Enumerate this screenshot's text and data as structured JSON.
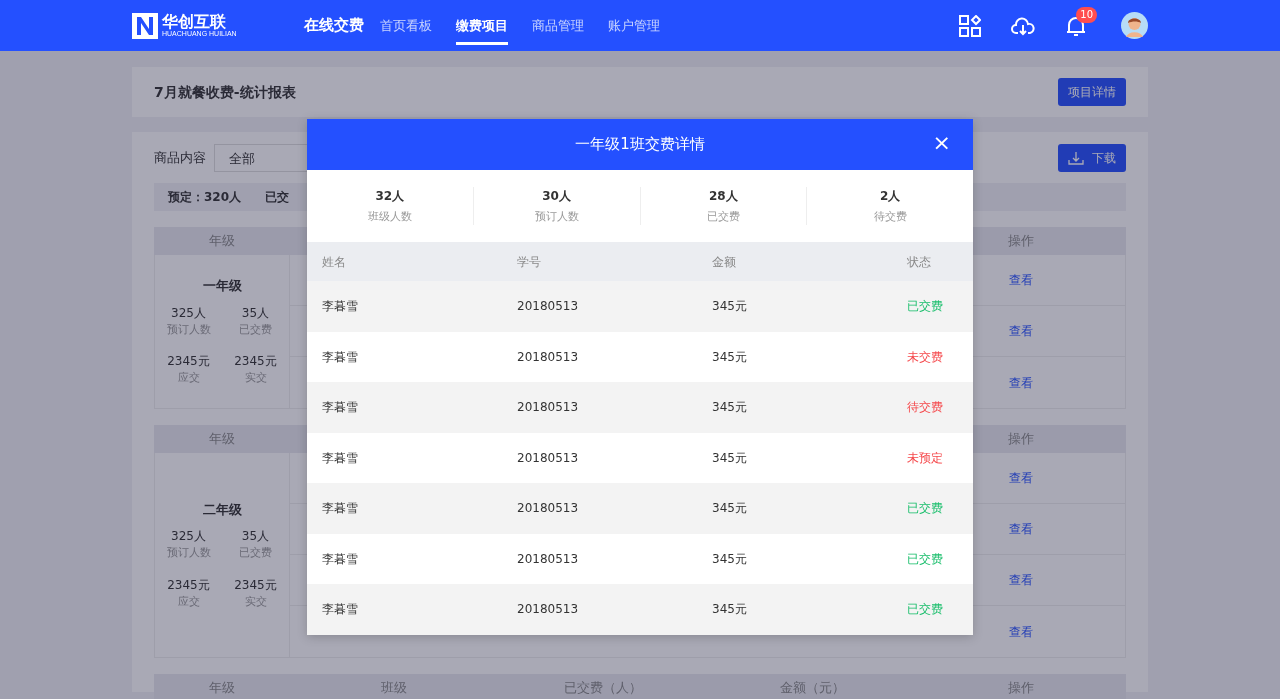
{
  "nav": {
    "logo_text": "华创互联",
    "logo_subtext": "HUACHUANG HUILIAN",
    "app_title": "在线交费",
    "tabs": [
      {
        "label": "首页看板",
        "selected": false
      },
      {
        "label": "缴费项目",
        "selected": true
      },
      {
        "label": "商品管理",
        "selected": false
      },
      {
        "label": "账户管理",
        "selected": false
      }
    ],
    "notification_count": "10"
  },
  "page": {
    "title": "7月就餐收费-统计报表",
    "detail_button": "项目详情",
    "filter_label": "商品内容",
    "filter_value": "全部",
    "download_button": "下载",
    "summary": [
      "预定：320人",
      "已交"
    ]
  },
  "grades": [
    {
      "header": [
        "年级",
        "操作"
      ],
      "name": "一年级",
      "stats": [
        {
          "value": "325人",
          "label": "预订人数"
        },
        {
          "value": "35人",
          "label": "已交费"
        },
        {
          "value": "2345元",
          "label": "应交"
        },
        {
          "value": "2345元",
          "label": "实交"
        }
      ],
      "rows": [
        {
          "action": "查看"
        },
        {
          "action": "查看"
        },
        {
          "action": "查看"
        }
      ]
    },
    {
      "header": [
        "年级",
        "操作"
      ],
      "name": "二年级",
      "stats": [
        {
          "value": "325人",
          "label": "预订人数"
        },
        {
          "value": "35人",
          "label": "已交费"
        },
        {
          "value": "2345元",
          "label": "应交"
        },
        {
          "value": "2345元",
          "label": "实交"
        }
      ],
      "rows": [
        {
          "action": "查看"
        },
        {
          "action": "查看"
        },
        {
          "action": "查看"
        },
        {
          "action": "查看"
        }
      ]
    }
  ],
  "last_header": [
    "年级",
    "班级",
    "已交费（人）",
    "金额（元）",
    "操作"
  ],
  "modal": {
    "title": "一年级1班交费详情",
    "close": "×",
    "stats": [
      {
        "value": "32人",
        "label": "班级人数"
      },
      {
        "value": "30人",
        "label": "预订人数"
      },
      {
        "value": "28人",
        "label": "已交费"
      },
      {
        "value": "2人",
        "label": "待交费"
      }
    ],
    "columns": [
      "姓名",
      "学号",
      "金额",
      "状态"
    ],
    "rows": [
      {
        "name": "李暮雪",
        "id": "20180513",
        "amount": "345元",
        "status": "已交费",
        "kind": "paid"
      },
      {
        "name": "李暮雪",
        "id": "20180513",
        "amount": "345元",
        "status": "未交费",
        "kind": "unpaid"
      },
      {
        "name": "李暮雪",
        "id": "20180513",
        "amount": "345元",
        "status": "待交费",
        "kind": "unpaid"
      },
      {
        "name": "李暮雪",
        "id": "20180513",
        "amount": "345元",
        "status": "未预定",
        "kind": "unpaid"
      },
      {
        "name": "李暮雪",
        "id": "20180513",
        "amount": "345元",
        "status": "已交费",
        "kind": "paid"
      },
      {
        "name": "李暮雪",
        "id": "20180513",
        "amount": "345元",
        "status": "已交费",
        "kind": "paid"
      },
      {
        "name": "李暮雪",
        "id": "20180513",
        "amount": "345元",
        "status": "已交费",
        "kind": "paid"
      }
    ]
  }
}
